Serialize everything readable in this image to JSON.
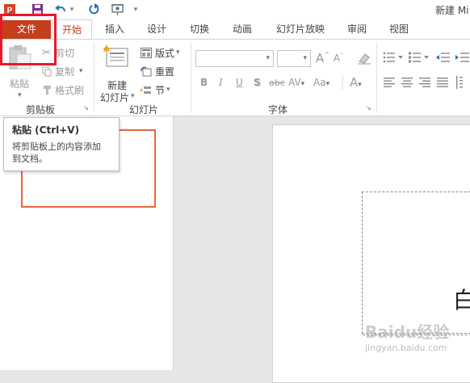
{
  "titlebar": {
    "title": "新建 Mi"
  },
  "tabs": [
    "文件",
    "开始",
    "插入",
    "设计",
    "切换",
    "动画",
    "幻灯片放映",
    "审阅",
    "视图"
  ],
  "clipboard": {
    "paste_label": "粘贴",
    "cut_label": "剪切",
    "copy_label": "复制",
    "format_painter_label": "格式刷",
    "group_label": "剪贴板"
  },
  "slides": {
    "new_slide_line1": "新建",
    "new_slide_line2": "幻灯片",
    "layout_label": "版式",
    "reset_label": "重置",
    "section_label": "节",
    "group_label": "幻灯片"
  },
  "font": {
    "group_label": "字体",
    "bold": "B",
    "italic": "I",
    "underline": "U",
    "shadow": "S",
    "strikethrough": "abc",
    "spacing": "AV",
    "change_case": "Aa",
    "color": "A"
  },
  "tooltip": {
    "title": "粘贴 (Ctrl+V)",
    "line1": "将剪贴板上的内容添加",
    "line2": "到文档。"
  },
  "slide_text": "白",
  "watermark": {
    "line1": "Baidu经验",
    "line2": "jingyan.baidu.com"
  },
  "colors": {
    "file_tab": "#c43e1c",
    "accent": "#d24726",
    "highlight_box": "#e8182b",
    "thumbnail_border": "#e8663a"
  }
}
